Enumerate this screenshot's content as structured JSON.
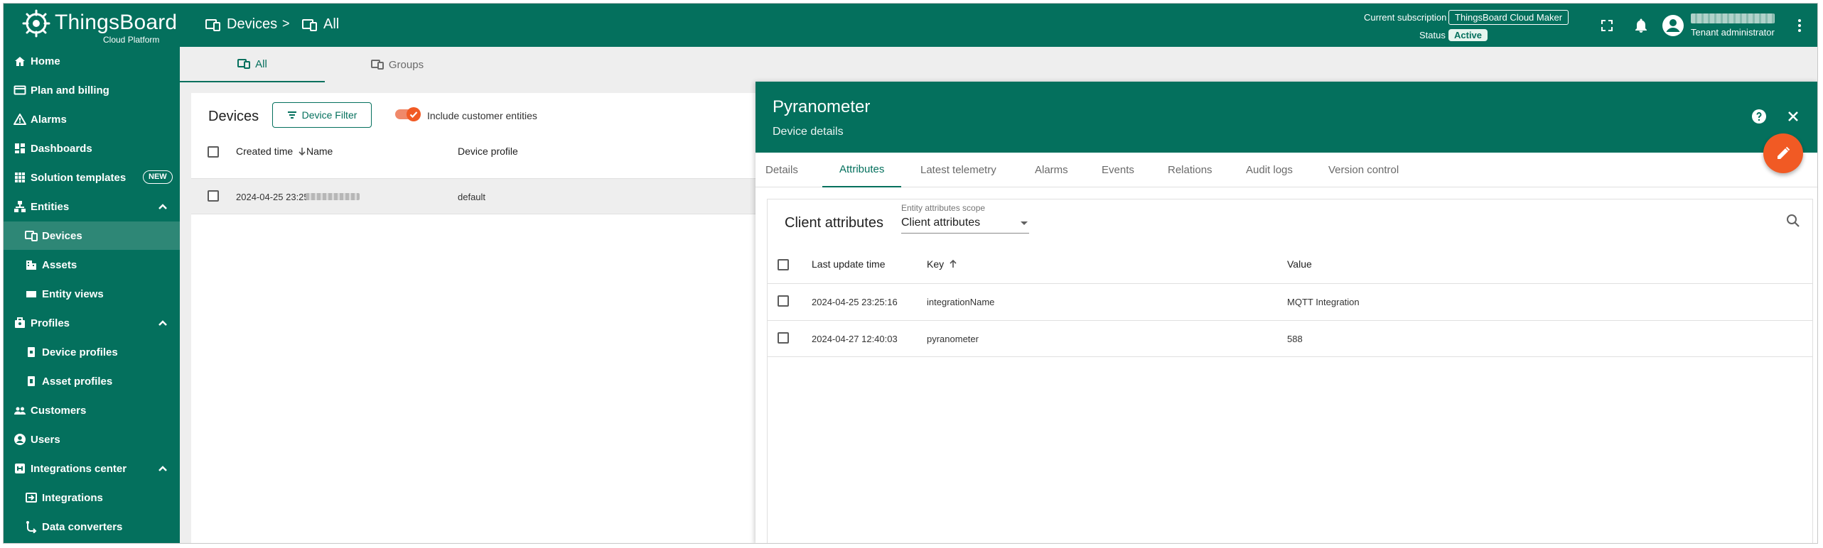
{
  "app": {
    "brand_title": "ThingsBoard",
    "brand_subtitle": "Cloud Platform"
  },
  "breadcrumb": {
    "items": [
      {
        "label": "Devices",
        "icon": "devices-icon"
      },
      {
        "label": "All",
        "icon": "devices-icon"
      }
    ],
    "separator": ">"
  },
  "header": {
    "subscription_label": "Current subscription",
    "subscription_value": "ThingsBoard Cloud Maker",
    "status_label": "Status",
    "status_value": "Active",
    "user_role": "Tenant administrator"
  },
  "sidebar": {
    "items": [
      {
        "label": "Home",
        "icon": "home-icon"
      },
      {
        "label": "Plan and billing",
        "icon": "billing-icon"
      },
      {
        "label": "Alarms",
        "icon": "alarm-icon"
      },
      {
        "label": "Dashboards",
        "icon": "dashboard-icon"
      },
      {
        "label": "Solution templates",
        "icon": "grid-icon",
        "badge": "NEW"
      },
      {
        "label": "Entities",
        "icon": "entities-icon",
        "expanded": true
      },
      {
        "label": "Devices",
        "icon": "devices-icon",
        "active": true
      },
      {
        "label": "Assets",
        "icon": "asset-icon"
      },
      {
        "label": "Entity views",
        "icon": "entity-view-icon"
      },
      {
        "label": "Profiles",
        "icon": "profiles-icon",
        "expanded": true
      },
      {
        "label": "Device profiles",
        "icon": "device-profile-icon"
      },
      {
        "label": "Asset profiles",
        "icon": "asset-profile-icon"
      },
      {
        "label": "Customers",
        "icon": "customers-icon"
      },
      {
        "label": "Users",
        "icon": "user-icon"
      },
      {
        "label": "Integrations center",
        "icon": "integrations-center-icon",
        "expanded": true
      },
      {
        "label": "Integrations",
        "icon": "integration-icon"
      },
      {
        "label": "Data converters",
        "icon": "converter-icon"
      }
    ]
  },
  "main_tabs": [
    {
      "label": "All",
      "active": true
    },
    {
      "label": "Groups",
      "active": false
    }
  ],
  "devices_table": {
    "title": "Devices",
    "filter_button": "Device Filter",
    "include_customer_label": "Include customer entities",
    "include_customer_on": true,
    "columns": [
      "Created time",
      "Name",
      "Device profile"
    ],
    "rows": [
      {
        "created_time": "2024-04-25 23:25:16",
        "name": "",
        "device_profile": "default"
      }
    ]
  },
  "details": {
    "title": "Pyranometer",
    "subtitle": "Device details",
    "tabs": [
      {
        "label": "Details"
      },
      {
        "label": "Attributes",
        "active": true
      },
      {
        "label": "Latest telemetry"
      },
      {
        "label": "Alarms"
      },
      {
        "label": "Events"
      },
      {
        "label": "Relations"
      },
      {
        "label": "Audit logs"
      },
      {
        "label": "Version control"
      }
    ],
    "attributes": {
      "title": "Client attributes",
      "scope_label": "Entity attributes scope",
      "scope_value": "Client attributes",
      "columns": [
        "Last update time",
        "Key",
        "Value"
      ],
      "rows": [
        {
          "last_update": "2024-04-25 23:25:16",
          "key": "integrationName",
          "value": "MQTT Integration"
        },
        {
          "last_update": "2024-04-27 12:40:03",
          "key": "pyranometer",
          "value": "588"
        }
      ]
    }
  },
  "colors": {
    "primary": "#04705d",
    "accent": "#f15a24",
    "sidebar_active": "#2e8776"
  }
}
